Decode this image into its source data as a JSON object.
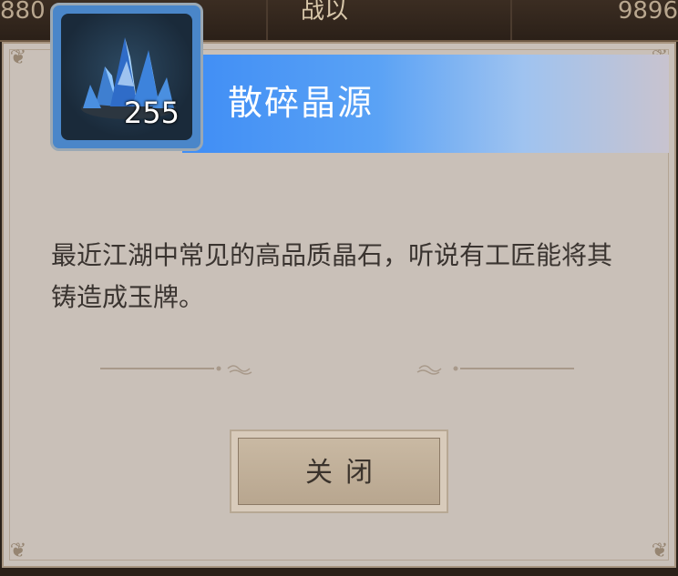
{
  "background": {
    "top_left": "880",
    "top_center": "战以",
    "top_right": "9896"
  },
  "item": {
    "name": "散碎晶源",
    "count": "255",
    "icon": "blue-crystal-icon"
  },
  "description": "最近江湖中常见的高品质晶石，听说有工匠能将其铸造成玉牌。",
  "buttons": {
    "close_label": "关闭"
  },
  "colors": {
    "title_banner": "#3f8df5",
    "panel": "#c9c0b8",
    "button": "#c1b19b"
  }
}
